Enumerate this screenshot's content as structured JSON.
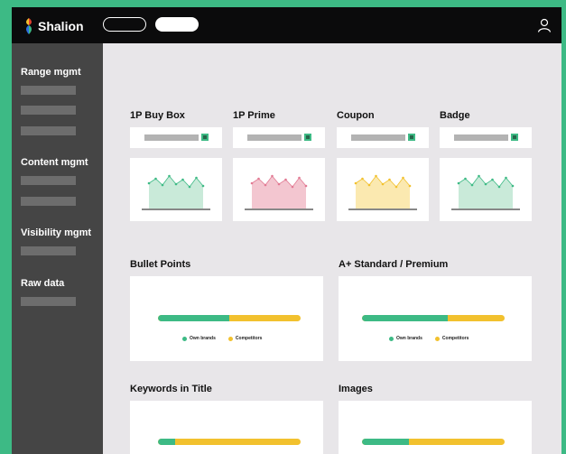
{
  "app": {
    "name": "Shalion"
  },
  "sidebar": {
    "sections": [
      {
        "title": "Range mgmt"
      },
      {
        "title": "Content mgmt"
      },
      {
        "title": "Visibility mgmt"
      },
      {
        "title": "Raw data"
      }
    ]
  },
  "metrics": [
    {
      "label": "1P Buy Box",
      "color": "green"
    },
    {
      "label": "1P Prime",
      "color": "pink"
    },
    {
      "label": "Coupon",
      "color": "yellow"
    },
    {
      "label": "Badge",
      "color": "green"
    }
  ],
  "progress_panels": [
    {
      "title": "Bullet Points",
      "own_share": 0.5,
      "show_legend": true
    },
    {
      "title": "A+ Standard / Premium",
      "own_share": 0.6,
      "show_legend": true
    },
    {
      "title": "Keywords in Title",
      "own_share": 0.12,
      "show_legend": false
    },
    {
      "title": "Images",
      "own_share": 0.33,
      "show_legend": false
    }
  ],
  "legend": {
    "own": "Own brands",
    "competitors": "Competitors"
  },
  "colors": {
    "brand_green": "#3dba85",
    "yellow": "#f2c12e",
    "pink": "#f3c6d0",
    "pink_line": "#e27a93",
    "green_area": "#c9ead9",
    "yellow_area": "#fbe9b0",
    "dark": "#0b0b0c",
    "sidebar": "#454545"
  }
}
